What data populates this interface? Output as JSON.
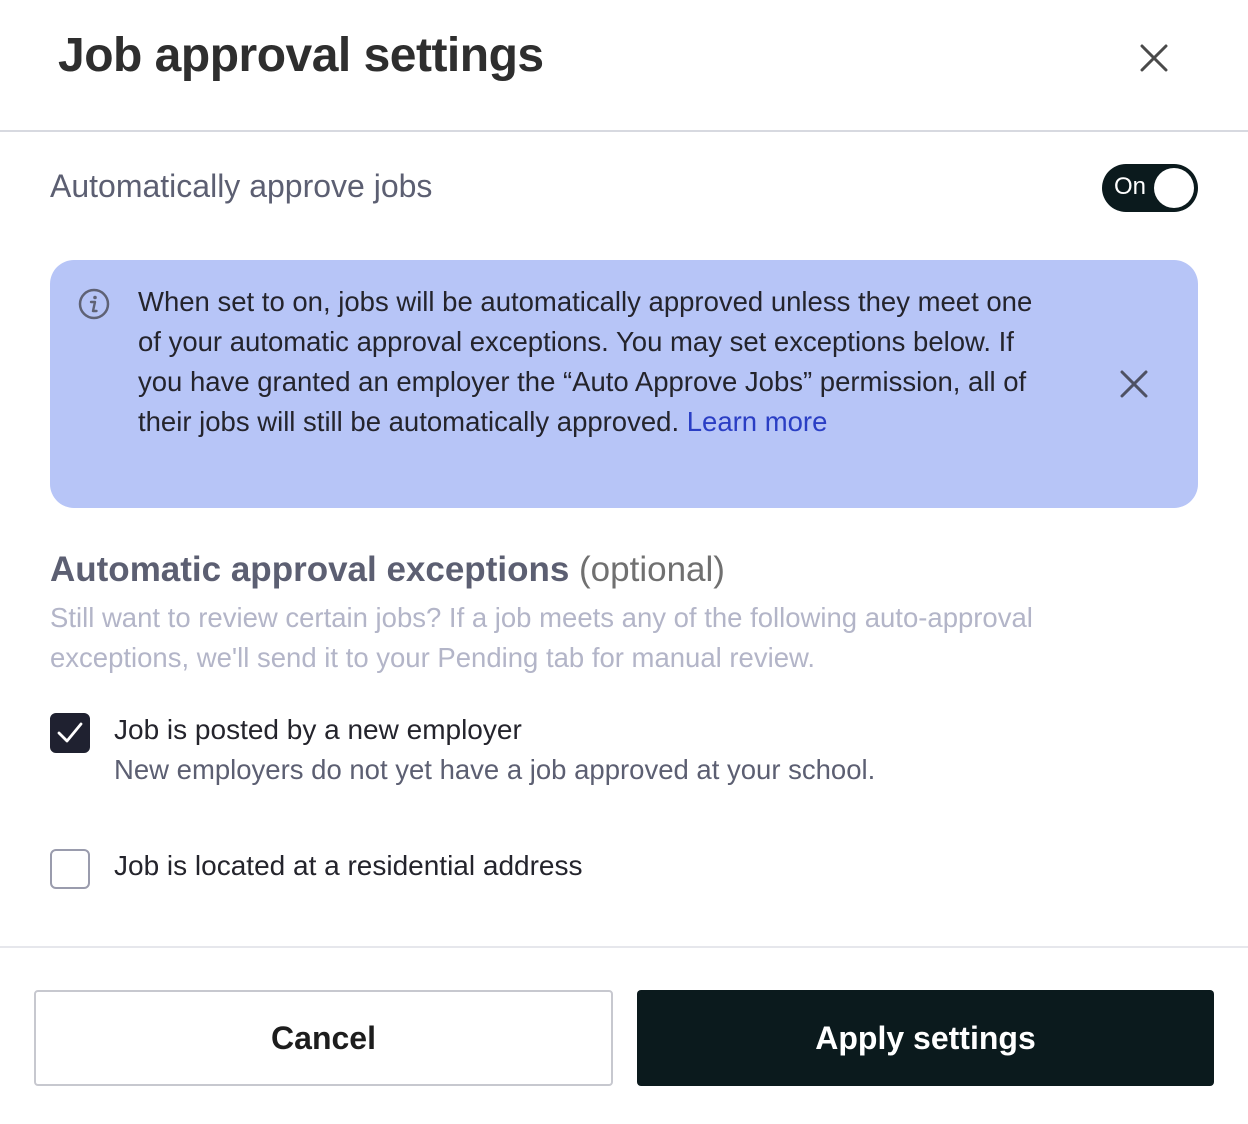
{
  "dialog": {
    "title": "Job approval settings",
    "close_icon": "close-icon"
  },
  "auto_approve": {
    "label": "Automatically approve jobs",
    "toggle_text": "On",
    "toggle_state": true
  },
  "info_banner": {
    "icon": "info-icon",
    "text": "When set to on, jobs will be automatically approved unless they meet one of your automatic approval exceptions. You may set exceptions below. If you have granted an employer the “Auto Approve Jobs” permission, all of their jobs will still be automatically approved. ",
    "link_text": "Learn more",
    "close_icon": "close-icon",
    "background_color": "#b7c5f7"
  },
  "exceptions": {
    "title": "Automatic approval exceptions",
    "optional_label": "(optional)",
    "description": "Still want to review certain jobs? If a job meets any of the following auto-approval exceptions, we'll send it to your Pending tab for manual review.",
    "options": [
      {
        "label": "Job is posted by a new employer",
        "description": "New employers do not yet have a job approved at your school.",
        "checked": true
      },
      {
        "label": "Job is located at a residential address",
        "description": "",
        "checked": false
      }
    ]
  },
  "footer": {
    "cancel_label": "Cancel",
    "apply_label": "Apply settings",
    "primary_color": "#0b1a1d"
  }
}
